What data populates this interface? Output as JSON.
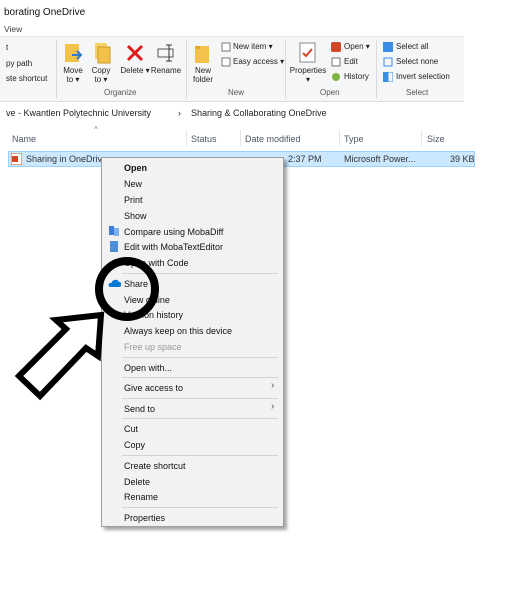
{
  "window": {
    "title": "borating OneDrive",
    "tab": "View"
  },
  "ribbon": {
    "clipboard": {
      "pin": "t",
      "copy_path": "py path",
      "paste_shortcut": "ste shortcut"
    },
    "organize": {
      "move_to": "Move\nto ▾",
      "copy_to": "Copy\nto ▾",
      "delete": "Delete ▾",
      "rename": "Rename",
      "group": "Organize"
    },
    "new": {
      "new_folder": "New\nfolder",
      "new_item": "New item ▾",
      "easy_access": "Easy access ▾",
      "group": "New"
    },
    "open": {
      "properties": "Properties\n▾",
      "open": "Open ▾",
      "edit": "Edit",
      "history": "History",
      "group": "Open"
    },
    "select": {
      "select_all": "Select all",
      "select_none": "Select none",
      "invert": "Invert selection",
      "group": "Select"
    }
  },
  "address": {
    "segment1": "ve - Kwantlen Polytechnic University",
    "segment2": "Sharing & Collaborating OneDrive",
    "separator": "›"
  },
  "columns": {
    "name": "Name",
    "status": "Status",
    "date": "Date modified",
    "type": "Type",
    "size": "Size"
  },
  "file": {
    "name": "Sharing in OneDriv",
    "date": "2:37 PM",
    "type": "Microsoft Power...",
    "size": "39 KB"
  },
  "menu": {
    "open": "Open",
    "new": "New",
    "print": "Print",
    "show": "Show",
    "compare": "Compare using MobaDiff",
    "edit_moba": "Edit with MobaTextEditor",
    "open_code": "Open with Code",
    "share": "Share",
    "view_online": "View online",
    "version_history": "Version history",
    "always_keep": "Always keep on this device",
    "free_up": "Free up space",
    "open_with": "Open with...",
    "give_access": "Give access to",
    "send_to": "Send to",
    "cut": "Cut",
    "copy": "Copy",
    "create_shortcut": "Create shortcut",
    "delete": "Delete",
    "rename": "Rename",
    "properties": "Properties"
  },
  "colors": {
    "selection": "#cce8ff",
    "highlight_circle": "#000000",
    "onedrive": "#0078d4"
  }
}
